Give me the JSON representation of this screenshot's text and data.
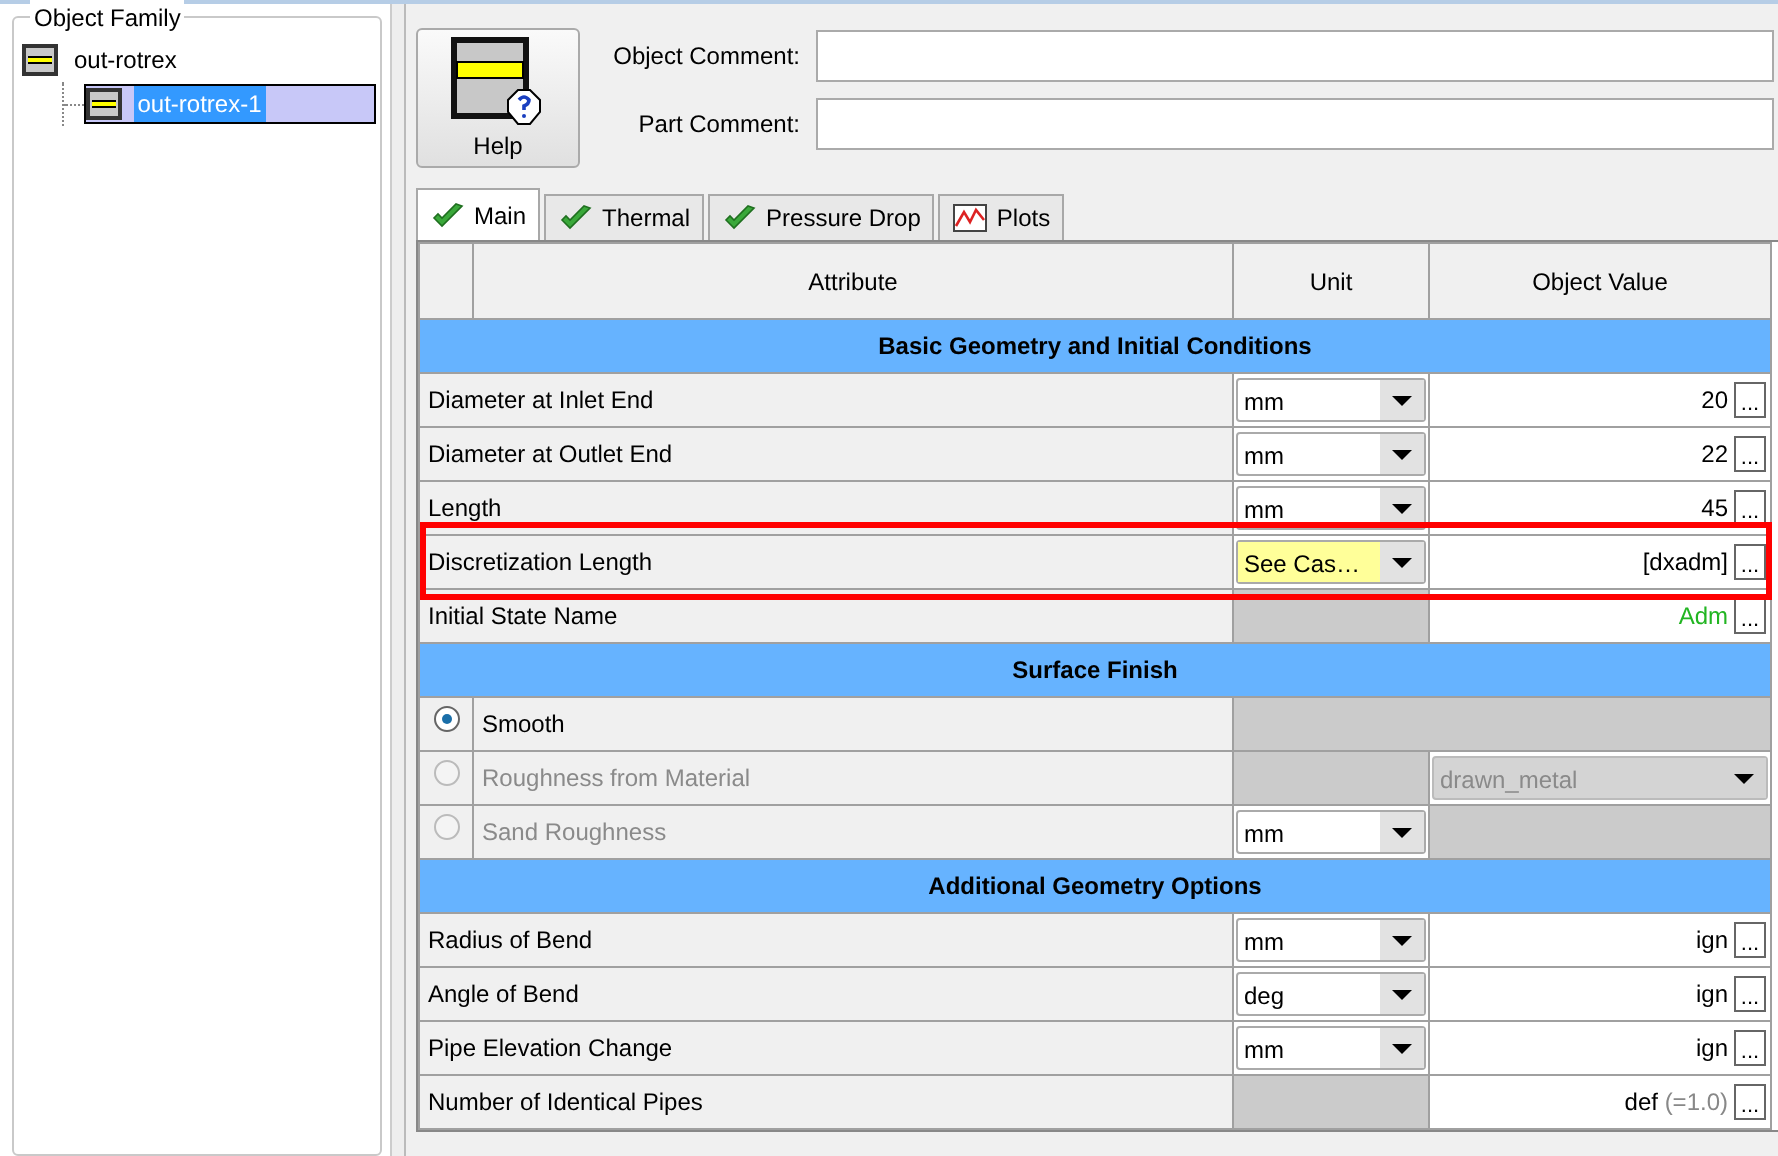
{
  "tree": {
    "title": "Object Family",
    "items": [
      {
        "label": "out-rotrex",
        "selected": false,
        "children": [
          {
            "label": "out-rotrex-1",
            "selected": true
          }
        ]
      }
    ]
  },
  "help_button": {
    "label": "Help"
  },
  "comments": [
    {
      "label": "Object Comment:"
    },
    {
      "label": "Part Comment:"
    }
  ],
  "tabs": [
    {
      "label": "Main",
      "kind": "check",
      "selected": true
    },
    {
      "label": "Thermal",
      "kind": "check",
      "selected": false
    },
    {
      "label": "Pressure Drop",
      "kind": "check",
      "selected": false
    },
    {
      "label": "Plots",
      "kind": "chart",
      "selected": false
    }
  ],
  "table": {
    "columns": [
      "Attribute",
      "Unit",
      "Object Value"
    ],
    "rows": [
      {
        "kind": "section",
        "label": "Basic Geometry and Initial Conditions"
      },
      {
        "kind": "param",
        "attribute": "Diameter at Inlet End",
        "unit": "mm",
        "value": "20",
        "button": "..."
      },
      {
        "kind": "param",
        "attribute": "Diameter at Outlet End",
        "unit": "mm",
        "value": "22",
        "button": "..."
      },
      {
        "kind": "param",
        "attribute": "Length",
        "unit": "mm",
        "value": "45",
        "button": "..."
      },
      {
        "kind": "param",
        "attribute": "Discretization Length",
        "unit": "See Cas…",
        "unit_highlighted": true,
        "value": "[dxadm]",
        "button": "...",
        "highlighted": true
      },
      {
        "kind": "param",
        "attribute": "Initial State Name",
        "value": "Adm",
        "color": "#22b522",
        "button": "..."
      },
      {
        "kind": "section",
        "label": "Surface Finish"
      },
      {
        "kind": "radio",
        "attribute": "Smooth",
        "selected": true,
        "disabled": false
      },
      {
        "kind": "radio",
        "attribute": "Roughness from Material",
        "selected": false,
        "disabled": true,
        "value_select": "drawn_metal"
      },
      {
        "kind": "radio",
        "attribute": "Sand Roughness",
        "selected": false,
        "disabled": true,
        "unit": "mm"
      },
      {
        "kind": "section",
        "label": "Additional Geometry Options"
      },
      {
        "kind": "param",
        "attribute": "Radius of Bend",
        "unit": "mm",
        "value": "ign",
        "button": "..."
      },
      {
        "kind": "param",
        "attribute": "Angle of Bend",
        "unit": "deg",
        "value": "ign",
        "button": "..."
      },
      {
        "kind": "param",
        "attribute": "Pipe Elevation Change",
        "unit": "mm",
        "value": "ign",
        "button": "..."
      },
      {
        "kind": "param",
        "attribute": "Number of Identical Pipes",
        "value": "def",
        "value_note": "(=1.0)",
        "button": "..."
      }
    ]
  }
}
